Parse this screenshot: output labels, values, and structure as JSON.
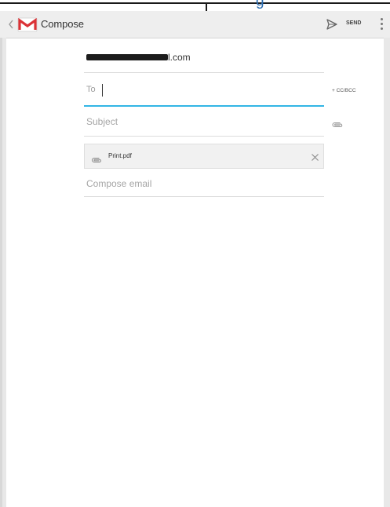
{
  "top_strip": {
    "fragment_text": "g"
  },
  "action_bar": {
    "title": "Compose",
    "send_label": "SEND"
  },
  "compose": {
    "from_suffix": "l.com",
    "to_label": "To",
    "cc_bcc_label": "+ CC/BCC",
    "subject_placeholder": "Subject",
    "attachment_name": "Print.pdf",
    "body_placeholder": "Compose email"
  },
  "icons": {
    "up": "chevron-left-icon",
    "app": "gmail-logo-icon",
    "send": "send-icon",
    "overflow": "overflow-menu-icon",
    "attach": "attachment-icon",
    "remove": "close-icon"
  },
  "colors": {
    "accent": "#33b5e5",
    "gmail_red": "#db3236",
    "action_bar": "#eeeeee"
  }
}
